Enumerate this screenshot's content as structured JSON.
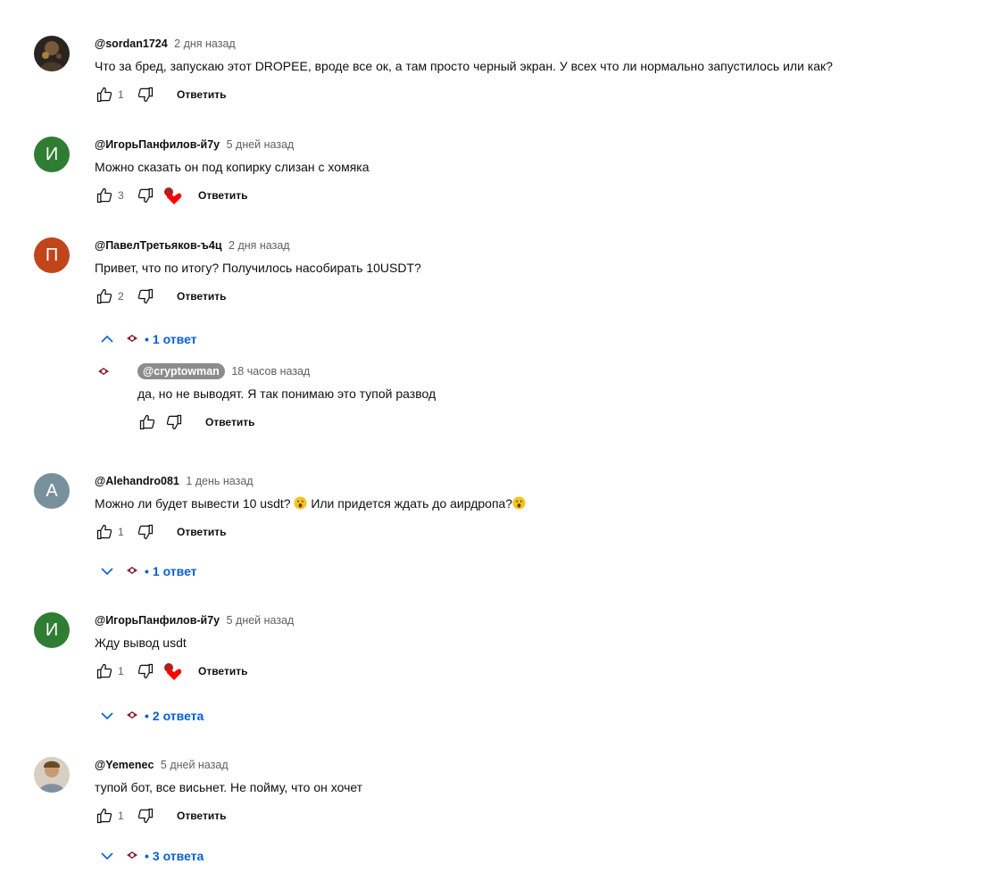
{
  "colors": {
    "accent": "#065fd4",
    "heart": "#ff0000"
  },
  "comments": [
    {
      "author": "@sordan1724",
      "time": "2 дня назад",
      "text": "Что за бред, запускаю этот DROPEE, вроде все ок, а там просто черный экран. У всех что ли нормально запустилось или как?",
      "likes": "1",
      "reply_label": "Ответить",
      "avatar": "photo-dark"
    },
    {
      "author": "@ИгорьПанфилов-й7у",
      "time": "5 дней назад",
      "text": "Можно сказать он под копирку слизан с хомяка",
      "likes": "3",
      "reply_label": "Ответить",
      "avatar_letter": "И",
      "avatar_color": "#2f7d32",
      "creator_heart": true
    },
    {
      "author": "@ПавелТретьяков-ъ4ц",
      "time": "2 дня назад",
      "text": "Привет, что по итогу? Получилось насобирать 10USDT?",
      "likes": "2",
      "reply_label": "Ответить",
      "avatar_letter": "П",
      "avatar_color": "#c1441a",
      "replies_label": "1 ответ",
      "expanded": true,
      "reply": {
        "author": "@cryptowman",
        "time": "18 часов назад",
        "text": "да, но не выводят. Я так понимаю это тупой развод",
        "likes": "",
        "reply_label": "Ответить"
      }
    },
    {
      "author": "@Alehandro081",
      "time": "1 день назад",
      "text_before": "Можно ли будет вывести 10 usdt?",
      "text_middle": "Или придется ждать до аирдропа?",
      "likes": "1",
      "reply_label": "Ответить",
      "avatar_letter": "A",
      "avatar_color": "#78909c",
      "replies_label": "1 ответ",
      "emoji": "astonished-face"
    },
    {
      "author": "@ИгорьПанфилов-й7у",
      "time": "5 дней назад",
      "text": "Жду вывод usdt",
      "likes": "1",
      "reply_label": "Ответить",
      "avatar_letter": "И",
      "avatar_color": "#2f7d32",
      "creator_heart": true,
      "replies_label": "2 ответа"
    },
    {
      "author": "@Yemenec",
      "time": "5 дней назад",
      "text": "тупой бот, все висьнет. Не пойму, что он хочет",
      "likes": "1",
      "reply_label": "Ответить",
      "avatar": "photo-light",
      "replies_label": "3 ответа"
    }
  ]
}
